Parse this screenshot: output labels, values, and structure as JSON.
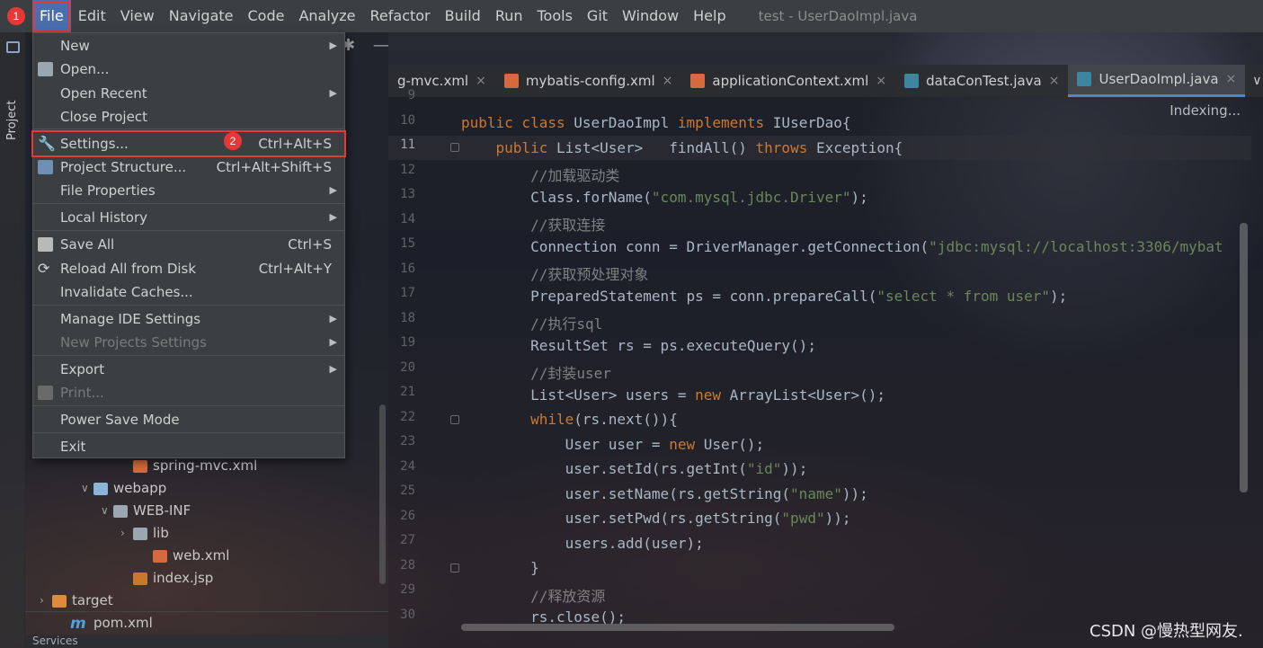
{
  "window": {
    "title": "test - UserDaoImpl.java"
  },
  "menubar": {
    "items": [
      "File",
      "Edit",
      "View",
      "Navigate",
      "Code",
      "Analyze",
      "Refactor",
      "Build",
      "Run",
      "Tools",
      "Git",
      "Window",
      "Help"
    ]
  },
  "annotations": {
    "badge1": "1",
    "badge2": "2"
  },
  "file_menu": {
    "items": [
      {
        "label": "New",
        "submenu": true
      },
      {
        "label": "Open...",
        "icon": "folder-open-icon"
      },
      {
        "label": "Open Recent",
        "submenu": true
      },
      {
        "label": "Close Project"
      },
      {
        "label": "Settings...",
        "shortcut": "Ctrl+Alt+S",
        "icon": "wrench-icon"
      },
      {
        "label": "Project Structure...",
        "shortcut": "Ctrl+Alt+Shift+S",
        "icon": "project-structure-icon"
      },
      {
        "label": "File Properties",
        "submenu": true
      },
      {
        "label": "Local History",
        "submenu": true
      },
      {
        "label": "Save All",
        "shortcut": "Ctrl+S",
        "icon": "save-icon"
      },
      {
        "label": "Reload All from Disk",
        "shortcut": "Ctrl+Alt+Y",
        "icon": "reload-icon"
      },
      {
        "label": "Invalidate Caches..."
      },
      {
        "label": "Manage IDE Settings",
        "submenu": true
      },
      {
        "label": "New Projects Settings",
        "submenu": true,
        "disabled": true
      },
      {
        "label": "Export",
        "submenu": true
      },
      {
        "label": "Print...",
        "disabled": true,
        "icon": "print-icon"
      },
      {
        "label": "Power Save Mode"
      },
      {
        "label": "Exit"
      }
    ]
  },
  "toolwindow": {
    "project_label": "Project"
  },
  "project_tree": {
    "rows": [
      {
        "label": "spring-mvc.xml",
        "type": "xml"
      },
      {
        "label": "webapp",
        "type": "folder-web",
        "expanded": true
      },
      {
        "label": "WEB-INF",
        "type": "folder",
        "expanded": true
      },
      {
        "label": "lib",
        "type": "folder",
        "expanded": false
      },
      {
        "label": "web.xml",
        "type": "xml"
      },
      {
        "label": "index.jsp",
        "type": "jsp"
      },
      {
        "label": "target",
        "type": "folder-orange",
        "expanded": false
      },
      {
        "label": "pom.xml",
        "type": "maven"
      }
    ],
    "maven_icon_glyph": "m"
  },
  "editor_tabs": [
    {
      "label": "g-mvc.xml",
      "icon": "xml-file-icon"
    },
    {
      "label": "mybatis-config.xml",
      "icon": "xml-file-icon"
    },
    {
      "label": "applicationContext.xml",
      "icon": "xml-file-icon"
    },
    {
      "label": "dataConTest.java",
      "icon": "java-file-icon"
    },
    {
      "label": "UserDaoImpl.java",
      "icon": "java-file-icon",
      "active": true
    }
  ],
  "editor": {
    "status": "Indexing...",
    "line_numbers": [
      "9",
      "10",
      "11",
      "12",
      "13",
      "14",
      "15",
      "16",
      "17",
      "18",
      "19",
      "20",
      "21",
      "22",
      "23",
      "24",
      "25",
      "26",
      "27",
      "28",
      "29",
      "30"
    ],
    "current_line": "11"
  },
  "code": [
    {
      "ln": "10",
      "parts": [
        [
          "kw",
          "public class "
        ],
        [
          "",
          "UserDaoImpl "
        ],
        [
          "kw",
          "implements "
        ],
        [
          "",
          "IUserDao{"
        ]
      ]
    },
    {
      "ln": "11",
      "parts": [
        [
          "",
          "    "
        ],
        [
          "kw",
          "public "
        ],
        [
          "",
          "List<User>   findAll() "
        ],
        [
          "kw",
          "throws "
        ],
        [
          "",
          "Exception{"
        ]
      ]
    },
    {
      "ln": "12",
      "parts": [
        [
          "",
          "        "
        ],
        [
          "cmt",
          "//加载驱动类"
        ]
      ]
    },
    {
      "ln": "13",
      "parts": [
        [
          "",
          "        Class.forName("
        ],
        [
          "str",
          "\"com.mysql.jdbc.Driver\""
        ],
        [
          "",
          ");"
        ]
      ]
    },
    {
      "ln": "14",
      "parts": [
        [
          "",
          "        "
        ],
        [
          "cmt",
          "//获取连接"
        ]
      ]
    },
    {
      "ln": "15",
      "parts": [
        [
          "",
          "        Connection conn = DriverManager.getConnection("
        ],
        [
          "str",
          "\"jdbc:mysql://localhost:3306/mybat"
        ]
      ]
    },
    {
      "ln": "16",
      "parts": [
        [
          "",
          "        "
        ],
        [
          "cmt",
          "//获取预处理对象"
        ]
      ]
    },
    {
      "ln": "17",
      "parts": [
        [
          "",
          "        PreparedStatement ps = conn.prepareCall("
        ],
        [
          "str",
          "\"select * from user\""
        ],
        [
          "",
          ");"
        ]
      ]
    },
    {
      "ln": "18",
      "parts": [
        [
          "",
          "        "
        ],
        [
          "cmt",
          "//执行sql"
        ]
      ]
    },
    {
      "ln": "19",
      "parts": [
        [
          "",
          "        ResultSet rs = ps.executeQuery();"
        ]
      ]
    },
    {
      "ln": "20",
      "parts": [
        [
          "",
          "        "
        ],
        [
          "cmt",
          "//封装user"
        ]
      ]
    },
    {
      "ln": "21",
      "parts": [
        [
          "",
          "        List<User> users = "
        ],
        [
          "kw",
          "new "
        ],
        [
          "",
          "ArrayList<User>();"
        ]
      ]
    },
    {
      "ln": "22",
      "parts": [
        [
          "",
          "        "
        ],
        [
          "kw",
          "while"
        ],
        [
          "",
          "(rs.next()){"
        ]
      ]
    },
    {
      "ln": "23",
      "parts": [
        [
          "",
          "            User user = "
        ],
        [
          "kw",
          "new "
        ],
        [
          "",
          "User();"
        ]
      ]
    },
    {
      "ln": "24",
      "parts": [
        [
          "",
          "            user.setId(rs.getInt("
        ],
        [
          "str",
          "\"id\""
        ],
        [
          "",
          "));"
        ]
      ]
    },
    {
      "ln": "25",
      "parts": [
        [
          "",
          "            user.setName(rs.getString("
        ],
        [
          "str",
          "\"name\""
        ],
        [
          "",
          "));"
        ]
      ]
    },
    {
      "ln": "26",
      "parts": [
        [
          "",
          "            user.setPwd(rs.getString("
        ],
        [
          "str",
          "\"pwd\""
        ],
        [
          "",
          "));"
        ]
      ]
    },
    {
      "ln": "27",
      "parts": [
        [
          "",
          "            users.add(user);"
        ]
      ]
    },
    {
      "ln": "28",
      "parts": [
        [
          "",
          "        }"
        ]
      ]
    },
    {
      "ln": "29",
      "parts": [
        [
          "",
          "        "
        ],
        [
          "cmt",
          "//释放资源"
        ]
      ]
    },
    {
      "ln": "30",
      "parts": [
        [
          "",
          "        rs.close();"
        ]
      ]
    }
  ],
  "watermark": "CSDN @慢热型网友.",
  "bottom_strip_text": "Services"
}
